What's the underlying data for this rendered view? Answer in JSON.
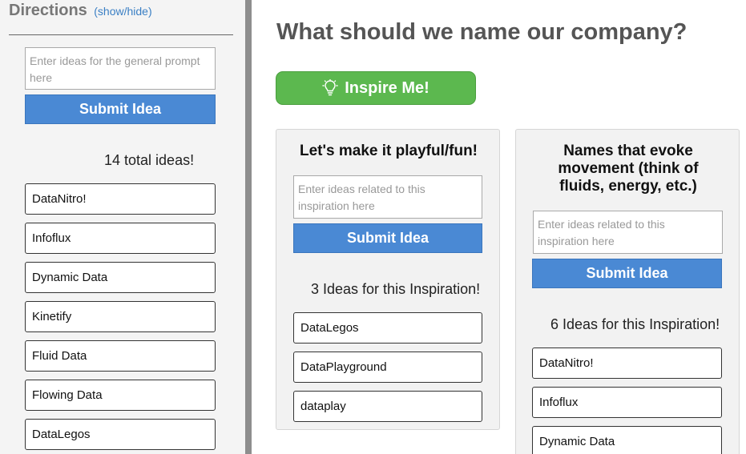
{
  "sidebar": {
    "directions_label": "Directions",
    "toggle_label": "(show/hide)",
    "prompt_placeholder": "Enter ideas for the general prompt here",
    "submit_label": "Submit Idea",
    "total_ideas": "14 total ideas!",
    "ideas": [
      "DataNitro!",
      "Infoflux",
      "Dynamic Data",
      "Kinetify",
      "Fluid Data",
      "Flowing Data",
      "DataLegos"
    ]
  },
  "main": {
    "title": "What should we name our company?",
    "inspire_label": "Inspire Me!",
    "cards": [
      {
        "title": "Let's make it playful/fun!",
        "placeholder": "Enter ideas related to this inspiration here",
        "submit_label": "Submit Idea",
        "count_text": "3 Ideas for this Inspiration!",
        "ideas": [
          "DataLegos",
          "DataPlayground",
          "dataplay"
        ]
      },
      {
        "title": "Names that evoke movement (think of fluids, energy, etc.)",
        "placeholder": "Enter ideas related to this inspiration here",
        "submit_label": "Submit Idea",
        "count_text": "6 Ideas for this Inspiration!",
        "ideas": [
          "DataNitro!",
          "Infoflux",
          "Dynamic Data"
        ]
      }
    ]
  },
  "colors": {
    "submit_blue": "#4a89d4",
    "inspire_green": "#5cb84f",
    "link_blue": "#3a7fc4"
  },
  "icons": {
    "inspire": "lightbulb-icon"
  }
}
